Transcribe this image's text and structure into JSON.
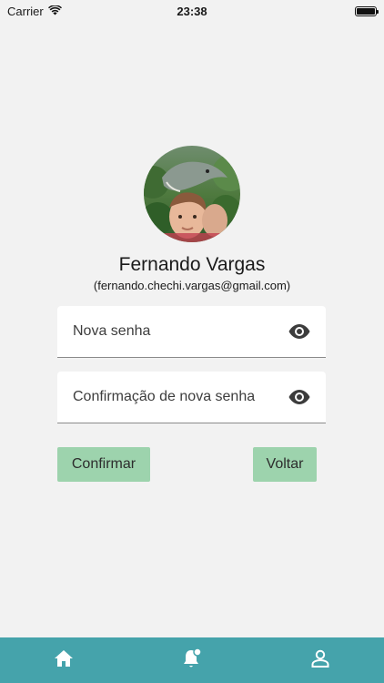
{
  "status_bar": {
    "carrier": "Carrier",
    "time": "23:38",
    "wifi_icon": "wifi-icon",
    "battery_icon": "battery-icon"
  },
  "profile": {
    "avatar": "avatar-photo",
    "name": "Fernando Vargas",
    "email": "(fernando.chechi.vargas@gmail.com)"
  },
  "form": {
    "new_password": {
      "placeholder": "Nova senha",
      "value": "",
      "icon": "eye-icon"
    },
    "confirm_password": {
      "placeholder": "Confirmação de nova senha",
      "value": "",
      "icon": "eye-icon"
    }
  },
  "actions": {
    "confirm_label": "Confirmar",
    "back_label": "Voltar",
    "button_color": "#9dd3ad"
  },
  "bottom_nav": {
    "background": "#45a3ab",
    "items": [
      {
        "icon": "home-icon"
      },
      {
        "icon": "notification-bell-icon"
      },
      {
        "icon": "profile-icon"
      }
    ]
  }
}
